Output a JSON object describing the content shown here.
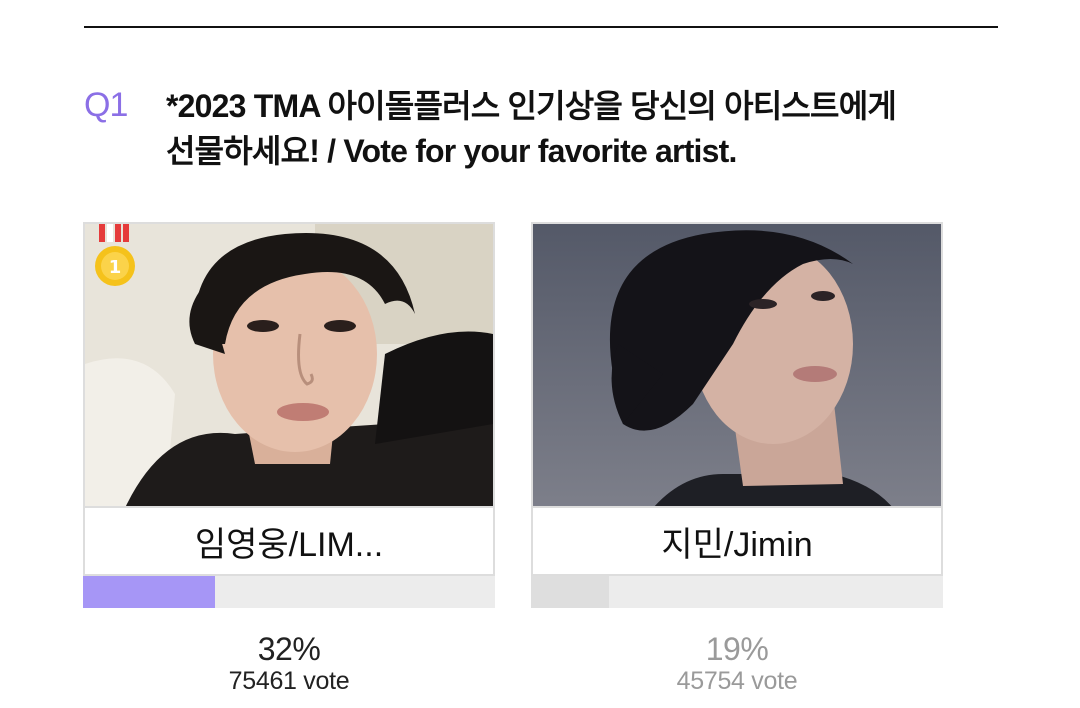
{
  "question": {
    "number": "Q1",
    "text_line1": "*2023 TMA 아이돌플러스 인기상을 당신의 아티스트에게",
    "text_line2": "선물하세요! / Vote for your favorite artist."
  },
  "candidates": [
    {
      "name": "임영웅/LIM...",
      "percent_label": "32%",
      "percent": 0.32,
      "votes_label": "75461 vote",
      "rank_badge": "1",
      "bar_color": "#a696f6"
    },
    {
      "name": "지민/Jimin",
      "percent_label": "19%",
      "percent": 0.19,
      "votes_label": "45754 vote",
      "bar_color": "#dedede"
    }
  ],
  "colors": {
    "accent": "#8b6fe6",
    "bar_track": "#ececec"
  }
}
